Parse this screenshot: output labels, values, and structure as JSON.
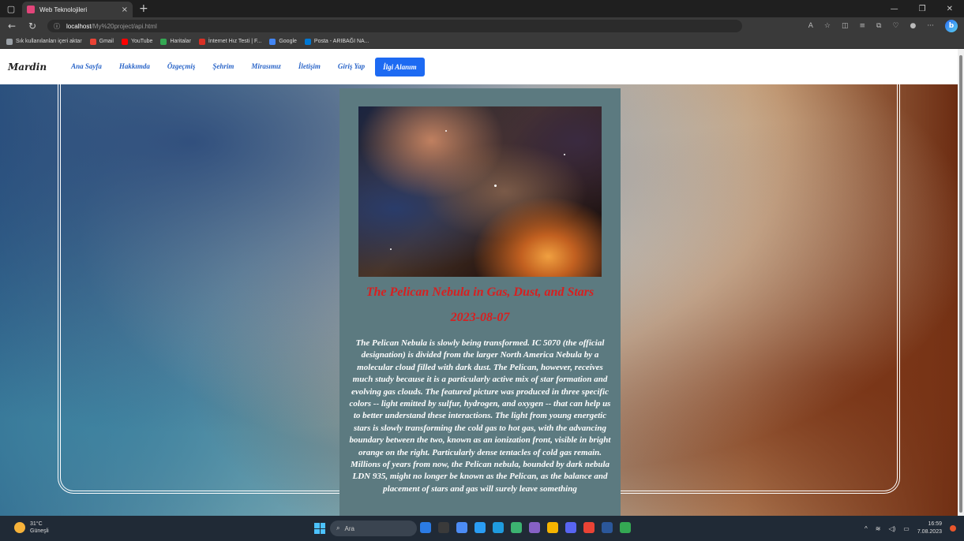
{
  "browser": {
    "tab_title": "Web Teknolojileri",
    "tab_close": "×",
    "new_tab": "+",
    "url_host": "localhost",
    "url_path": "/My%20project/api.html",
    "bookmarks": [
      {
        "label": "Sık kullanılanları içeri aktar",
        "color": "#9aa0a6"
      },
      {
        "label": "Gmail",
        "color": "#ea4335"
      },
      {
        "label": "YouTube",
        "color": "#ff0000"
      },
      {
        "label": "Haritalar",
        "color": "#34a853"
      },
      {
        "label": "İnternet Hız Testi | F...",
        "color": "#d93025"
      },
      {
        "label": "Google",
        "color": "#4285f4"
      },
      {
        "label": "Posta - ARIBAĞI NA...",
        "color": "#0078d4"
      }
    ]
  },
  "site": {
    "logo": "Mardin",
    "nav": [
      {
        "label": "Ana Sayfa",
        "active": false
      },
      {
        "label": "Hakkımda",
        "active": false
      },
      {
        "label": "Özgeçmiş",
        "active": false
      },
      {
        "label": "Şehrim",
        "active": false
      },
      {
        "label": "Mirasımız",
        "active": false
      },
      {
        "label": "İletişim",
        "active": false
      },
      {
        "label": "Giriş Yap",
        "active": false
      },
      {
        "label": "İlgi Alanım",
        "active": true
      }
    ]
  },
  "apod": {
    "title": "The Pelican Nebula in Gas, Dust, and Stars",
    "date": "2023-08-07",
    "explanation": "The Pelican Nebula is slowly being transformed. IC 5070 (the official designation) is divided from the larger North America Nebula by a molecular cloud filled with dark dust. The Pelican, however, receives much study because it is a particularly active mix of star formation and evolving gas clouds. The featured picture was produced in three specific colors -- light emitted by sulfur, hydrogen, and oxygen -- that can help us to better understand these interactions. The light from young energetic stars is slowly transforming the cold gas to hot gas, with the advancing boundary between the two, known as an ionization front, visible in bright orange on the right. Particularly dense tentacles of cold gas remain. Millions of years from now, the Pelican nebula, bounded by dark nebula LDN 935, might no longer be known as the Pelican, as the balance and placement of stars and gas will surely leave something"
  },
  "taskbar": {
    "weather_temp": "31°C",
    "weather_desc": "Güneşli",
    "search_placeholder": "Ara",
    "time": "16:59",
    "date": "7.08.2023",
    "apps": [
      "#2b7be4",
      "#3a3a3a",
      "#4c8cf5",
      "#2a9df4",
      "#1f9bde",
      "#3cb371",
      "#8661c5",
      "#f5b400",
      "#5865f2",
      "#ea4335",
      "#2b579a",
      "#34a853"
    ]
  }
}
